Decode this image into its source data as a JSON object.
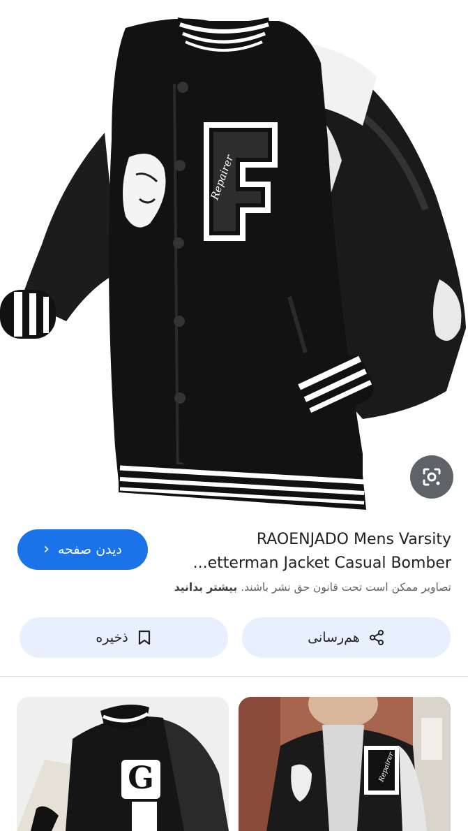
{
  "hero": {
    "image_alt": "Black varsity jacket with white F patch and leather sleeves",
    "patch_text": "Repairer"
  },
  "product": {
    "title_line1": "RAOENJADO Mens Varsity",
    "title_line2": "...etterman Jacket Casual Bomber",
    "visit_label": "دیدن صفحه"
  },
  "notice": {
    "text": "تصاویر ممکن است تحت قانون حق نشر باشند.",
    "learn_more": "بیشتر بدانید"
  },
  "actions": {
    "share_label": "هم‌رسانی",
    "save_label": "ذخیره"
  },
  "related": {
    "left_patch": "G",
    "right_patch_text": "Repairer"
  },
  "colors": {
    "accent": "#1a73e8",
    "button_bg": "#e8f0fe",
    "lens_bg": "#5f6368"
  }
}
